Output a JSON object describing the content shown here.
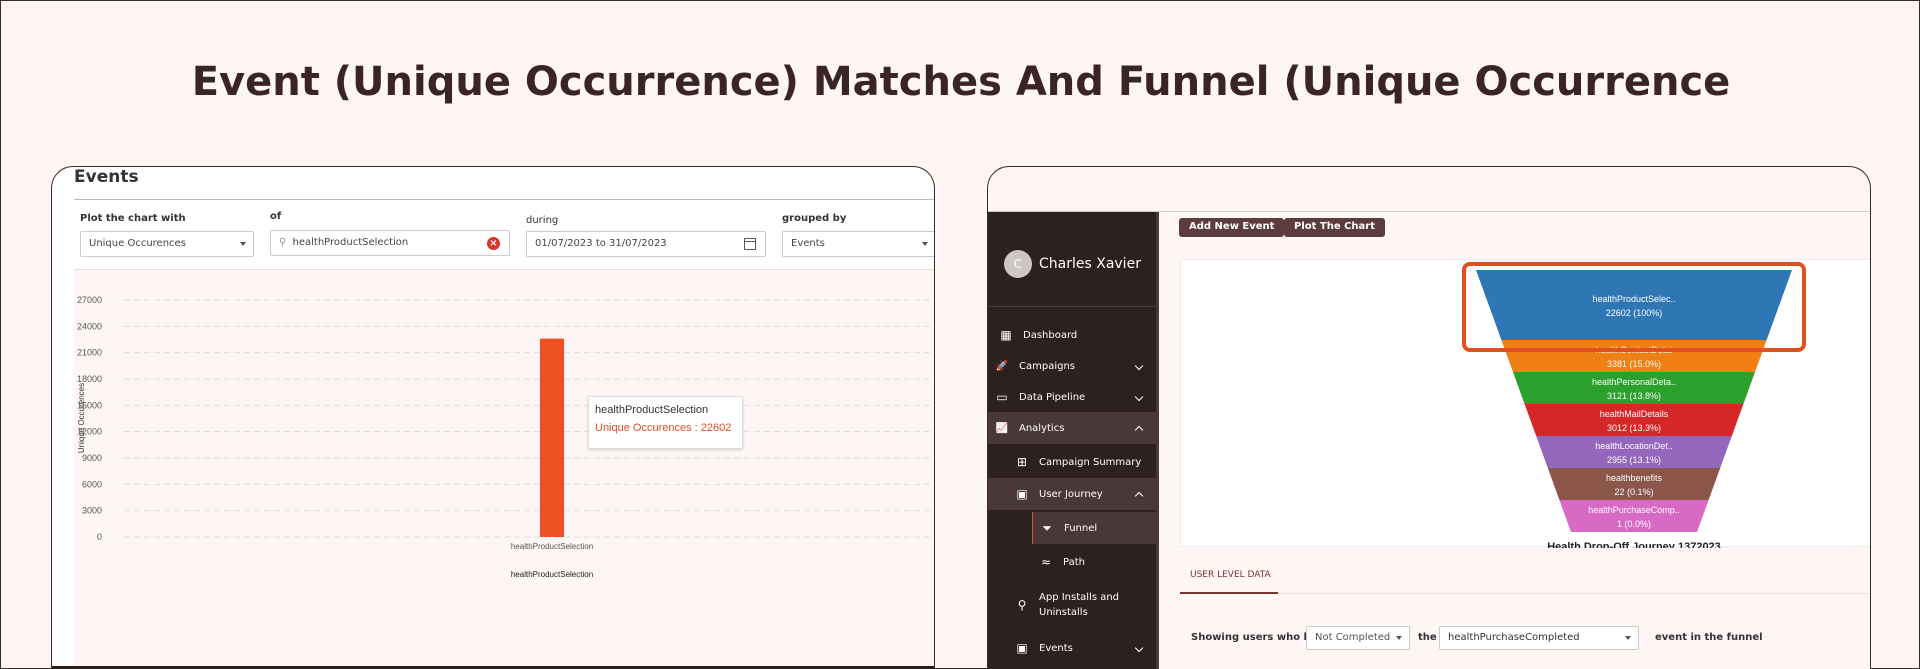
{
  "page_title": "Event (Unique Occurrence) Matches And Funnel (Unique Occurrence",
  "left": {
    "title": "Events",
    "filters": {
      "plot_label": "Plot the chart with",
      "plot_value": "Unique Occurences",
      "of_label": "of",
      "of_value": "healthProductSelection",
      "during_label": "during",
      "during_value": "01/07/2023 to 31/07/2023",
      "grouped_label": "grouped by",
      "grouped_value": "Events"
    },
    "tooltip": {
      "title": "healthProductSelection",
      "value_text": "Unique Occurences : 22602"
    }
  },
  "chart_data": {
    "type": "bar",
    "categories": [
      "healthProductSelection"
    ],
    "values": [
      22602
    ],
    "xlabel": "healthProductSelection",
    "ylabel": "Unique Occurences",
    "ylim": [
      0,
      27000
    ],
    "yticks": [
      0,
      3000,
      6000,
      9000,
      12000,
      15000,
      18000,
      21000,
      24000,
      27000
    ],
    "grid": true,
    "bar_color": "#ee5122"
  },
  "right": {
    "user": {
      "initial": "C",
      "name": "Charles Xavier"
    },
    "nav": [
      {
        "label": "Dashboard",
        "icon": "dashboard-icon",
        "glyph": "▦"
      },
      {
        "label": "Campaigns",
        "icon": "rocket-icon",
        "glyph": "🚀"
      },
      {
        "label": "Data Pipeline",
        "icon": "storage-icon",
        "glyph": "▭"
      },
      {
        "label": "Analytics",
        "icon": "trend-icon",
        "glyph": "📈"
      },
      {
        "label": "Campaign Summary",
        "icon": "tree-icon",
        "glyph": "⊞"
      },
      {
        "label": "User Journey",
        "icon": "calendar-icon",
        "glyph": "▣"
      },
      {
        "label": "Funnel",
        "icon": "funnel-icon",
        "glyph": "⏷"
      },
      {
        "label": "Path",
        "icon": "path-icon",
        "glyph": "≈"
      },
      {
        "label": "App Installs and",
        "label2": "Uninstalls",
        "icon": "joystick-icon",
        "glyph": "⚲"
      },
      {
        "label": "Events",
        "icon": "calendar-icon",
        "glyph": "▣"
      }
    ],
    "buttons": {
      "add": "Add New Event",
      "plot": "Plot The Chart"
    },
    "funnel": {
      "title": "Health Drop-Off Journey 1372023",
      "stages": [
        {
          "label": "healthProductSelec..",
          "value": "22602 (100%)",
          "color": "#2f77b4",
          "fraction": 1.0
        },
        {
          "label": "healthContactDetai",
          "value": "3381 (15.0%)",
          "color": "#f07f14",
          "fraction": 0.15
        },
        {
          "label": "healthPersonalDeta..",
          "value": "3121 (13.8%)",
          "color": "#2ca02c",
          "fraction": 0.138
        },
        {
          "label": "healthMailDetails",
          "value": "3012 (13.3%)",
          "color": "#d62728",
          "fraction": 0.133
        },
        {
          "label": "healthLocationDet..",
          "value": "2955 (13.1%)",
          "color": "#9467bd",
          "fraction": 0.131
        },
        {
          "label": "healthbenefits",
          "value": "22 (0.1%)",
          "color": "#8c564b",
          "fraction": 0.001
        },
        {
          "label": "healthPurchaseComp..",
          "value": "1 (0.0%)",
          "color": "#d869c4",
          "fraction": 0.0
        }
      ],
      "highlight_color": "#e0511f"
    },
    "tab_label": "USER LEVEL DATA",
    "userlevel": {
      "prefix": "Showing users who have",
      "status": "Not Completed",
      "the": "the",
      "event": "healthPurchaseCompleted",
      "suffix": "event in the funnel"
    }
  }
}
